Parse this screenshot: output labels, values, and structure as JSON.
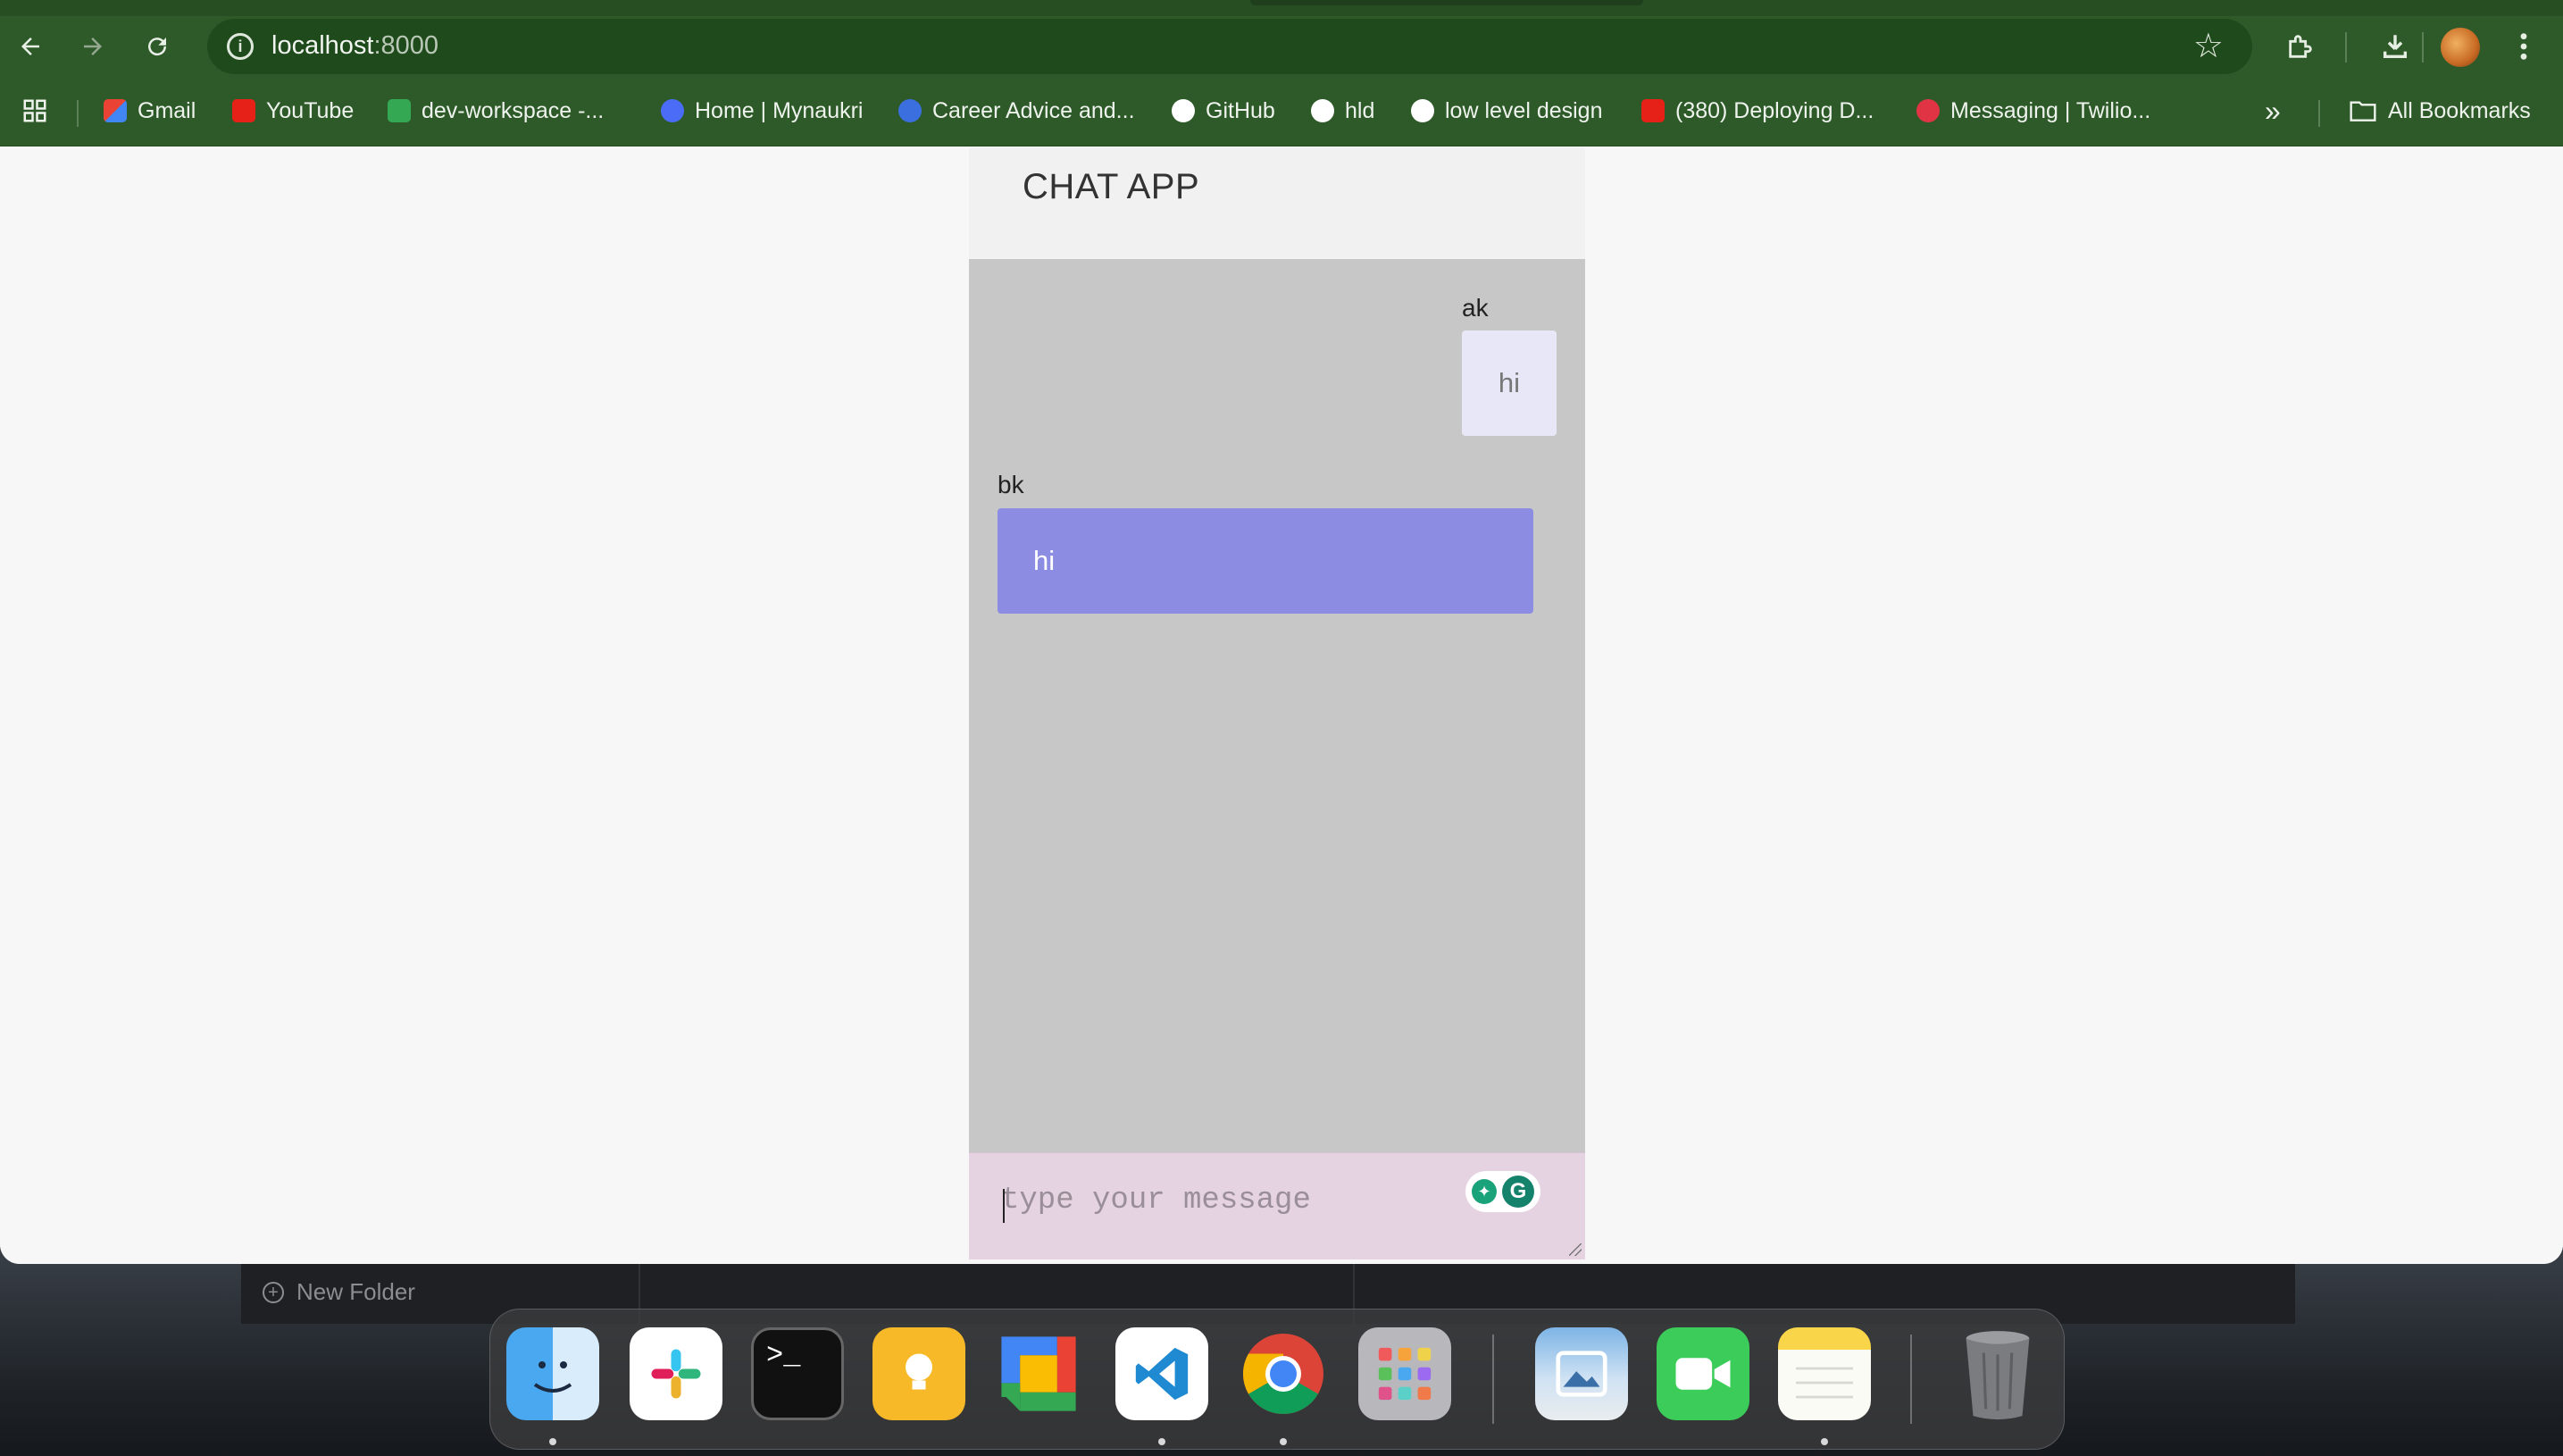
{
  "browser": {
    "url_host": "localhost",
    "url_port": ":8000",
    "icons": [
      "back-icon",
      "forward-icon",
      "reload-icon",
      "info-icon",
      "star-icon",
      "extensions-icon",
      "download-icon",
      "more-icon",
      "apps-grid-icon",
      "bookmarks-overflow-icon",
      "folder-icon"
    ]
  },
  "bookmarks": {
    "items": [
      {
        "label": "Gmail",
        "color": "#ea4335"
      },
      {
        "label": "YouTube",
        "color": "#e62117"
      },
      {
        "label": "dev-workspace -...",
        "color": "#34a853"
      },
      {
        "label": "Home | Mynaukri",
        "color": "#4a6cf7"
      },
      {
        "label": "Career Advice and...",
        "color": "#3b6fe0"
      },
      {
        "label": "GitHub",
        "color": "#ffffff"
      },
      {
        "label": "hld",
        "color": "#ffffff"
      },
      {
        "label": "low level design",
        "color": "#ffffff"
      },
      {
        "label": "(380) Deploying D...",
        "color": "#e62117"
      },
      {
        "label": "Messaging | Twilio...",
        "color": "#e03444"
      }
    ],
    "overflow": "»",
    "all_bookmarks": "All Bookmarks"
  },
  "chat": {
    "title": "CHAT APP",
    "messages": [
      {
        "sender": "ak",
        "text": "hi",
        "direction": "outgoing"
      },
      {
        "sender": "bk",
        "text": "hi",
        "direction": "incoming"
      }
    ],
    "input_placeholder": "type your message",
    "colors": {
      "panel_bg": "#c8c7c8",
      "outgoing_bubble": "#e8e7f8",
      "incoming_bubble": "#8c8ce2",
      "composer_bg": "#e6d3e2"
    }
  },
  "desktop": {
    "new_folder_label": "New Folder",
    "dock_apps": [
      "Finder",
      "Slack",
      "Terminal",
      "Keep",
      "Google Chat",
      "Visual Studio Code",
      "Google Chrome",
      "Launchpad",
      "Preview",
      "FaceTime",
      "Notes",
      "Trash"
    ]
  }
}
